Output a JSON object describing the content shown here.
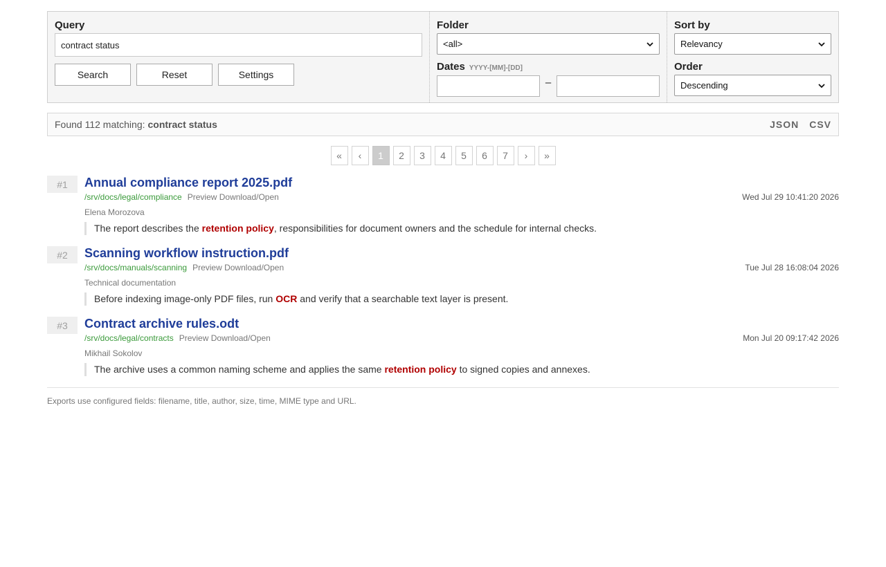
{
  "form": {
    "query_label": "Query",
    "query_value": "contract status",
    "buttons": {
      "search": "Search",
      "reset": "Reset",
      "settings": "Settings"
    },
    "folder_label": "Folder",
    "folder_value": "<all>",
    "dates_label": "Dates",
    "dates_hint": "YYYY-[MM]-[DD]",
    "dates_separator": "–",
    "date_from": "",
    "date_to": "",
    "sort_label": "Sort by",
    "sort_value": "Relevancy",
    "order_label": "Order",
    "order_value": "Descending"
  },
  "summary": {
    "prefix": "Found 112 matching:",
    "query": "contract status",
    "exports": [
      "JSON",
      "CSV"
    ]
  },
  "pager": {
    "first": "«",
    "prev": "‹",
    "pages": [
      "1",
      "2",
      "3",
      "4",
      "5",
      "6",
      "7"
    ],
    "current": "1",
    "next": "›",
    "last": "»"
  },
  "results": [
    {
      "rank": "#1",
      "title": "Annual compliance report 2025.pdf",
      "path": "/srv/docs/legal/compliance",
      "links": "Preview Download/Open",
      "date": "Wed Jul 29 10:41:20 2026",
      "author": "Elena Morozova",
      "snippet": {
        "before": "The report describes the ",
        "highlight": "retention policy",
        "after": ", responsibilities for document owners and the schedule for internal checks."
      }
    },
    {
      "rank": "#2",
      "title": "Scanning workflow instruction.pdf",
      "path": "/srv/docs/manuals/scanning",
      "links": "Preview Download/Open",
      "date": "Tue Jul 28 16:08:04 2026",
      "author": "Technical documentation",
      "snippet": {
        "before": "Before indexing image-only PDF files, run ",
        "highlight": "OCR",
        "after": " and verify that a searchable text layer is present."
      }
    },
    {
      "rank": "#3",
      "title": "Contract archive rules.odt",
      "path": "/srv/docs/legal/contracts",
      "links": "Preview Download/Open",
      "date": "Mon Jul 20 09:17:42 2026",
      "author": "Mikhail Sokolov",
      "snippet": {
        "before": "The archive uses a common naming scheme and applies the same ",
        "highlight": "retention policy",
        "after": " to signed copies and annexes."
      }
    }
  ],
  "footer": "Exports use configured fields: filename, title, author, size, time, MIME type and URL."
}
